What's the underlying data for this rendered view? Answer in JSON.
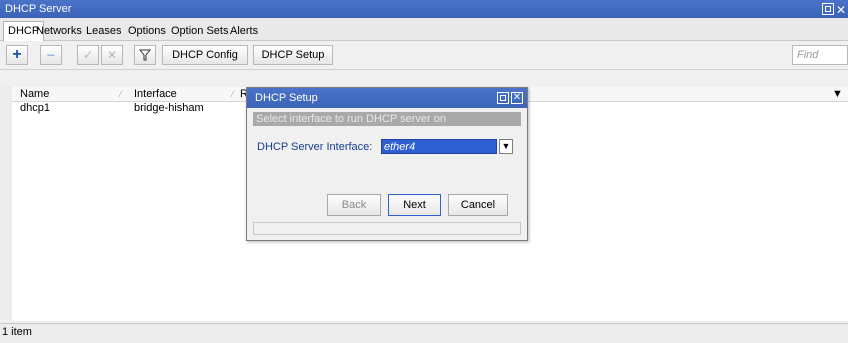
{
  "window": {
    "title": "DHCP Server"
  },
  "tabs": [
    "DHCP",
    "Networks",
    "Leases",
    "Options",
    "Option Sets",
    "Alerts"
  ],
  "toolbar": {
    "config_label": "DHCP Config",
    "setup_label": "DHCP Setup",
    "find_placeholder": "Find"
  },
  "table": {
    "columns": [
      "Name",
      "Interface",
      "Re"
    ],
    "rows": [
      {
        "name": "dhcp1",
        "interface": "bridge-hisham"
      }
    ]
  },
  "status": {
    "text": "1 item"
  },
  "dialog": {
    "title": "DHCP Setup",
    "info": "Select interface to run DHCP server on",
    "field_label": "DHCP Server Interface:",
    "field_value": "ether4",
    "buttons": {
      "back": "Back",
      "next": "Next",
      "cancel": "Cancel"
    }
  }
}
